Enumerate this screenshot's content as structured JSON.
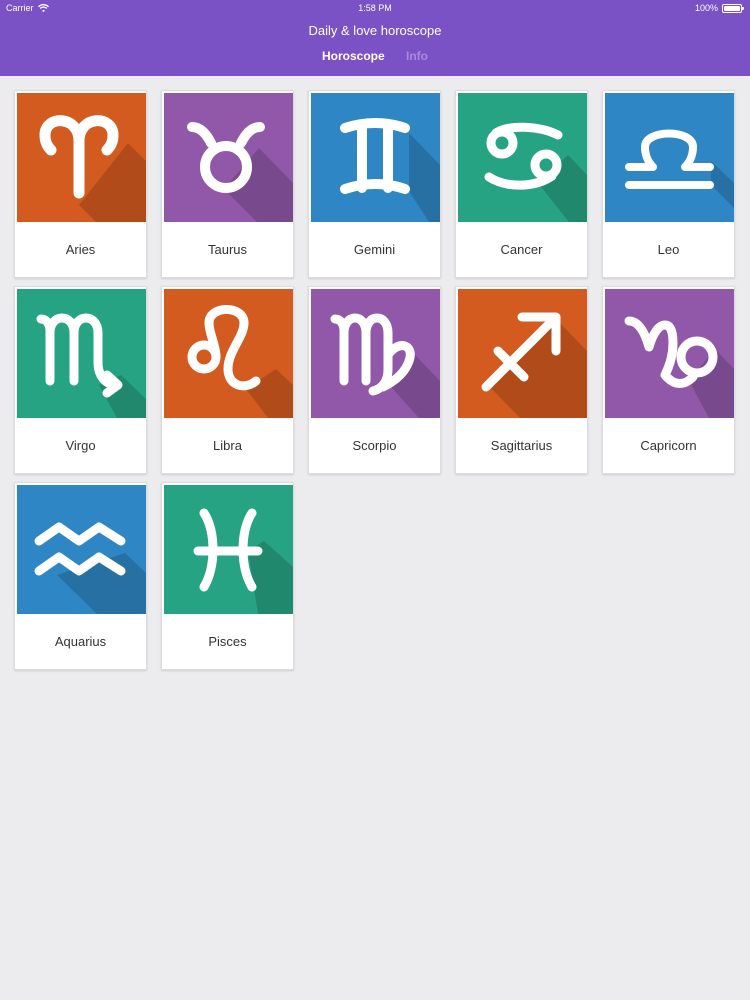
{
  "status_bar": {
    "carrier": "Carrier",
    "time": "1:58 PM",
    "battery": "100%"
  },
  "header": {
    "title": "Daily & love horoscope"
  },
  "tabs": [
    {
      "label": "Horoscope",
      "active": true
    },
    {
      "label": "Info",
      "active": false
    }
  ],
  "colors": {
    "header": "#7a52c6",
    "orange": "#d35b1f",
    "purple": "#9157a8",
    "blue": "#2f86c4",
    "teal": "#26a382"
  },
  "signs": [
    {
      "label": "Aries",
      "color": "#d35b1f",
      "icon": "aries-glyph"
    },
    {
      "label": "Taurus",
      "color": "#9157a8",
      "icon": "taurus-glyph"
    },
    {
      "label": "Gemini",
      "color": "#2f86c4",
      "icon": "gemini-glyph"
    },
    {
      "label": "Cancer",
      "color": "#26a382",
      "icon": "cancer-glyph"
    },
    {
      "label": "Leo",
      "color": "#2f86c4",
      "icon": "libra-glyph"
    },
    {
      "label": "Virgo",
      "color": "#26a382",
      "icon": "scorpio-glyph"
    },
    {
      "label": "Libra",
      "color": "#d35b1f",
      "icon": "leo-glyph"
    },
    {
      "label": "Scorpio",
      "color": "#9157a8",
      "icon": "virgo-glyph"
    },
    {
      "label": "Sagittarius",
      "color": "#d35b1f",
      "icon": "sagittarius-glyph"
    },
    {
      "label": "Capricorn",
      "color": "#9157a8",
      "icon": "capricorn-glyph"
    },
    {
      "label": "Aquarius",
      "color": "#2f86c4",
      "icon": "aquarius-glyph"
    },
    {
      "label": "Pisces",
      "color": "#26a382",
      "icon": "pisces-glyph"
    }
  ]
}
